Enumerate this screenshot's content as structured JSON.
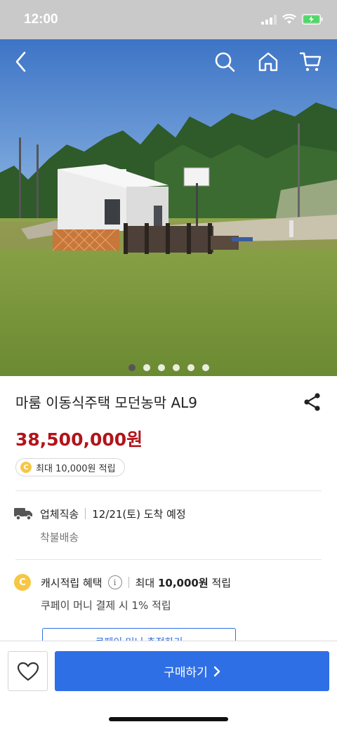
{
  "status_bar": {
    "time": "12:00"
  },
  "nav": {
    "back_icon": "chevron-left-icon",
    "search_icon": "search-icon",
    "home_icon": "home-icon",
    "cart_icon": "cart-icon"
  },
  "gallery": {
    "image_count": 6,
    "active_index": 0
  },
  "product": {
    "title": "마룸 이동식주택 모던농막 AL9",
    "price": "38,500,000원",
    "reward_badge": "최대 10,000원 적립"
  },
  "shipping": {
    "method": "업체직송",
    "arrival": "12/21(토) 도착 예정",
    "fee_type": "착불배송"
  },
  "cashback": {
    "label": "캐시적립 혜택",
    "amount_prefix": "최대 ",
    "amount": "10,000원",
    "amount_suffix": " 적립",
    "sub": "쿠페이 머니 결제 시 1% 적립",
    "outline_button_partial": "쿠페이 머니 충전하기"
  },
  "bottom": {
    "buy_label": "구매하기"
  },
  "colors": {
    "accent": "#2f6fe6",
    "price": "#b3131b",
    "coin": "#f6c744"
  }
}
